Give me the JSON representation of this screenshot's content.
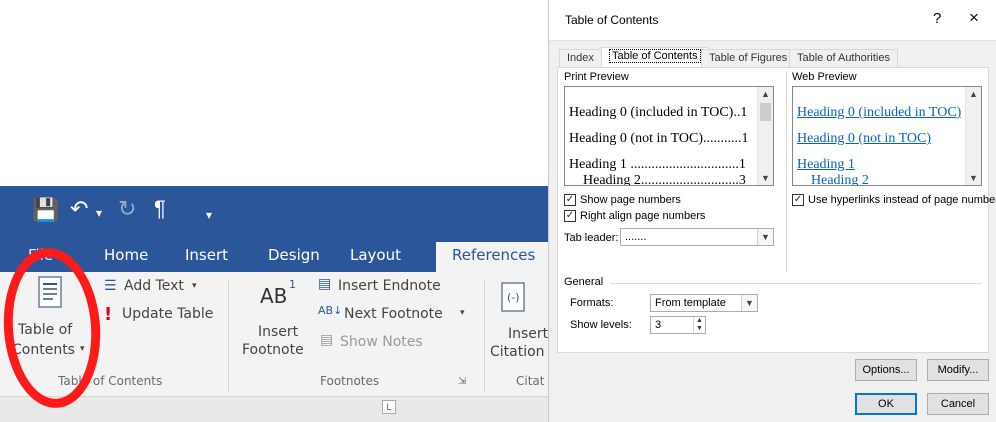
{
  "ribbon": {
    "tabs": [
      "File",
      "Home",
      "Insert",
      "Design",
      "Layout",
      "References"
    ],
    "active_tab": "References",
    "toc_group": {
      "button_line1": "Table of",
      "button_line2": "Contents",
      "add_text": "Add Text",
      "update_table": "Update Table",
      "label": "Table of Contents"
    },
    "footnotes_group": {
      "insert_footnote_line1": "Insert",
      "insert_footnote_line2": "Footnote",
      "footnote_glyph": "AB",
      "insert_endnote": "Insert Endnote",
      "next_footnote": "Next Footnote",
      "show_notes": "Show Notes",
      "label": "Footnotes"
    },
    "citation_group": {
      "insert_citation_line1": "Insert",
      "insert_citation_line2": "Citation",
      "label": "Citat"
    },
    "annotation_color": "#ff1a1a",
    "brand_color": "#2b579a"
  },
  "dialog": {
    "title": "Table of Contents",
    "help": "?",
    "close": "×",
    "tabs": [
      "Index",
      "Table of Contents",
      "Table of Figures",
      "Table of Authorities"
    ],
    "active_tab": "Table of Contents",
    "print_preview": {
      "label": "Print Preview",
      "lines": [
        "Heading 0 (included in TOC)..1",
        "Heading 0 (not in TOC)...........1",
        "Heading 1 ...............................1",
        "Heading 2............................3"
      ]
    },
    "web_preview": {
      "label": "Web Preview",
      "lines": [
        "Heading 0 (included in TOC)",
        "Heading 0 (not in TOC)",
        "Heading 1",
        "Heading 2"
      ]
    },
    "show_page_numbers": {
      "label": "Show page numbers",
      "checked": true
    },
    "right_align": {
      "label": "Right align page numbers",
      "checked": true
    },
    "use_hyperlinks": {
      "label": "Use hyperlinks instead of page numbers",
      "checked": true
    },
    "tab_leader": {
      "label": "Tab leader:",
      "value": "......."
    },
    "general_label": "General",
    "formats": {
      "label": "Formats:",
      "value": "From template"
    },
    "show_levels": {
      "label": "Show levels:",
      "value": "3"
    },
    "buttons": {
      "options": "Options...",
      "modify": "Modify...",
      "ok": "OK",
      "cancel": "Cancel"
    },
    "hyperlink_color": "#0563c1"
  }
}
